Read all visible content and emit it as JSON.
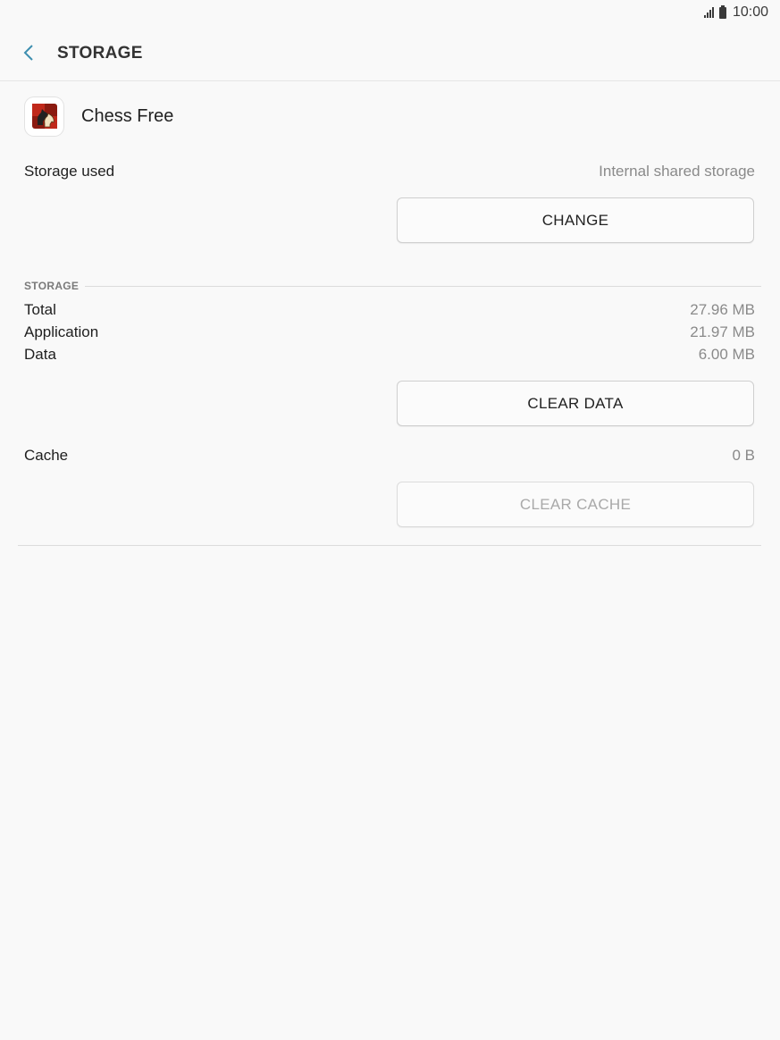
{
  "status_bar": {
    "time": "10:00"
  },
  "header": {
    "title": "STORAGE"
  },
  "app": {
    "name": "Chess Free"
  },
  "storage_used": {
    "label": "Storage used",
    "value": "Internal shared storage",
    "button_label": "CHANGE"
  },
  "storage_section": {
    "header": "STORAGE",
    "rows": [
      {
        "label": "Total",
        "value": "27.96 MB"
      },
      {
        "label": "Application",
        "value": "21.97 MB"
      },
      {
        "label": "Data",
        "value": "6.00 MB"
      }
    ],
    "clear_data_label": "CLEAR DATA"
  },
  "cache": {
    "label": "Cache",
    "value": "0 B",
    "clear_cache_label": "CLEAR CACHE"
  },
  "colors": {
    "accent": "#3e8fb0",
    "background": "#f9f9f9"
  }
}
